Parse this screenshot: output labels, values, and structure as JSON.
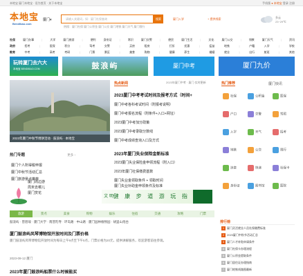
{
  "topbar": {
    "left_text": "本地宝 厦门本地宝 · 设为首页 · 关于本地宝",
    "right_prefix": "手机版",
    "right_accent": "● 本地宝",
    "right_suffix": "登录 注册"
  },
  "header": {
    "logo_cn": "本地宝",
    "logo_en": "Bendibao.com",
    "city": "厦门",
    "city_arrow": "▾",
    "search_placeholder": "请输入关键词，如：厦门社保查询",
    "search_button": "搜索",
    "hot_searches": "热搜：厦门社保 厦门公积金 厦门公交 厦门地铁 厦门天气 厦门限行",
    "mid_button_1": "厦门入学",
    "mid_button_2": "+ 提供线索",
    "weather_line_1": "多云",
    "weather_line_2": "23~29℃"
  },
  "nav": {
    "row1": [
      "社保",
      "厦门办事",
      "|",
      "大学",
      "厦门旅游",
      "|",
      "便利",
      "身份证",
      "|",
      "常识",
      "厦门交警",
      "|",
      "便民",
      "厦门生活",
      "|",
      "文化",
      "厦门公交",
      "|",
      "领教",
      "厦门天气",
      "|",
      "资讯"
    ],
    "row2": [
      "政府",
      "招考",
      "|",
      "医保",
      "积分",
      "|",
      "驾考",
      "交警",
      "|",
      "买房",
      "租房",
      "|",
      "打折",
      "优惠",
      "|",
      "疫苗",
      "地铁",
      "|",
      "户籍",
      "入学",
      "|",
      "学校"
    ],
    "row3": [
      "教育",
      "中考",
      "|",
      "高考",
      "考研",
      "|",
      "门票",
      "景区",
      "|",
      "美食",
      "购物",
      "|",
      "健康",
      "养生",
      "|",
      "婚姻",
      "就业",
      "|",
      "出行",
      "航班",
      "|",
      "其他"
    ]
  },
  "banners": {
    "b1_title": "玩转厦门去六大",
    "b1_sub": "本地宝 BENDIBAO.COM",
    "b2": "鼓浪屿",
    "b3": "厦门中考",
    "b4": "厦门九价"
  },
  "photo": {
    "caption": "2023年厦门中秋节博饼活动 · 鼓浪屿 · 本地宝"
  },
  "left_col": {
    "section_title": "热门专题",
    "section_more": "更多 ›",
    "items": [
      "厦门个人所得税申报",
      "厦门中秋节活动汇总",
      "厦门旅游景点推荐"
    ],
    "leaf_lines": [
      "厦门周边游",
      "周末去哪儿",
      "厦门赏花"
    ]
  },
  "news": {
    "tab": "热点新闻",
    "date_line": "2023年厦门中考 · 厦门·实时更新",
    "headline1": "2023厦门中考考试时间及报考方式（时间+",
    "items1": [
      {
        "text": "厦门中考各科考试时间（附报考说明）",
        "date": ""
      },
      {
        "text": "厦门中考报名流程（附条件+入口+网址）",
        "date": ""
      },
      {
        "text": "2023厦门中考加分政策",
        "date": ""
      },
      {
        "text": "2023厦门中考录取分数线",
        "date": ""
      },
      {
        "text": "厦门中考成绩查询入口及方式",
        "date": ""
      }
    ],
    "headline2": "2023年厦门失业保险金新标准",
    "items2": [
      {
        "text": "2023厦门失业保险金申领流程（附入口）",
        "date": ""
      },
      {
        "text": "2023年厦门社保缴费基数",
        "date": ""
      },
      {
        "text": "厦门失业金领取条件 + 领取时间",
        "date": ""
      },
      {
        "text": "厦门失业补助金申领条件及标准",
        "date": ""
      }
    ]
  },
  "kaozheng": {
    "left_char": "文 明",
    "title": "健 康 步 道 游 玩 指 南"
  },
  "tabs": [
    "旅游",
    "景点",
    "美食",
    "购物",
    "娱乐",
    "住宿",
    "交通",
    "攻略",
    "门票"
  ],
  "subtabs": "鼓浪屿 · 曾厝垵 · 厦门大学 · 南普陀寺 · 环岛路 · 中山路 · 厦门园林植物园 · 胡里山炮台",
  "main_list": [
    {
      "title": "厦门鼓浪屿风琴博物馆开放时间及门票价格",
      "desc": "厦门鼓浪屿风琴博物馆开放时间为每日上午9点至下午5点，门票价格为20元，提供讲解服务，欢迎游客前往参观。"
    },
    {
      "title": "",
      "desc": "2023-09-12 厦门"
    },
    {
      "title": "2023年厦门鼓浪屿船票什么时候能买",
      "desc": ""
    }
  ],
  "right": {
    "tab1": "热门推荐",
    "tab2": "厦门快讯",
    "grid": [
      {
        "label": "社保",
        "color": "#f3a13b"
      },
      {
        "label": "公积金",
        "color": "#4aa0e0"
      },
      {
        "label": "医保",
        "color": "#6dbb4c"
      },
      {
        "label": "户口",
        "color": "#e56c6c"
      },
      {
        "label": "交警",
        "color": "#8b7fd8"
      },
      {
        "label": "驾照",
        "color": "#f3a13b"
      },
      {
        "label": "入学",
        "color": "#4aa0e0"
      },
      {
        "label": "天气",
        "color": "#6dbb4c"
      },
      {
        "label": "招考",
        "color": "#e56c6c"
      },
      {
        "label": "地铁",
        "color": "#8b7fd8"
      },
      {
        "label": "公交",
        "color": "#f3a13b"
      },
      {
        "label": "限行",
        "color": "#4aa0e0"
      },
      {
        "label": "违章",
        "color": "#6dbb4c"
      },
      {
        "label": "快递",
        "color": "#e56c6c"
      },
      {
        "label": "社保卡",
        "color": "#8b7fd8"
      },
      {
        "label": "身份证",
        "color": "#f3a13b"
      },
      {
        "label": "图书馆",
        "color": "#4aa0e0"
      },
      {
        "label": "医院",
        "color": "#6dbb4c"
      }
    ],
    "list_head": "排行榜",
    "list": [
      {
        "n": "1",
        "text": "厦门灵活就业人员社保缴费标准"
      },
      {
        "n": "2",
        "text": "2023厦门中秋节活动汇总"
      },
      {
        "n": "3",
        "text": "厦门人才补贴申请条件"
      },
      {
        "n": "4",
        "text": "厦门社保卡办理流程"
      },
      {
        "n": "5",
        "text": "厦门公积金提取条件"
      },
      {
        "n": "6",
        "text": "厦门居住证办理指南"
      },
      {
        "n": "7",
        "text": "厦门地铁线路图最新"
      }
    ]
  },
  "colors": {
    "brand_orange": "#e8740c",
    "accent_red": "#e45a12",
    "green_tab": "#7bb848"
  }
}
